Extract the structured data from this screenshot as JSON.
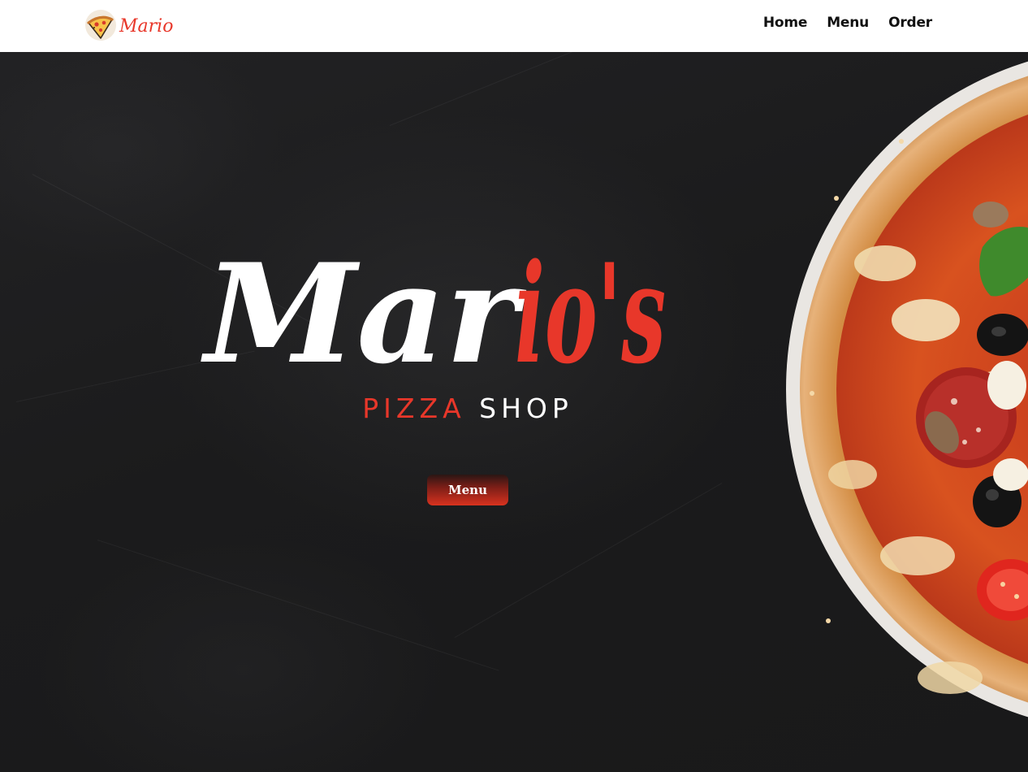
{
  "header": {
    "logo_text": "Mario",
    "logo_icon": "pizza-slice-icon",
    "nav": [
      {
        "label": "Home"
      },
      {
        "label": "Menu"
      },
      {
        "label": "Order"
      }
    ]
  },
  "hero": {
    "title_main": "Mar",
    "title_accent": "io's",
    "tagline_red": "PIZZA",
    "tagline_white": "SHOP",
    "button_label": "Menu",
    "decor_image": "pizza-photo"
  },
  "colors": {
    "accent": "#e8372a",
    "background": "#1c1c1d",
    "header_bg": "#ffffff",
    "text_light": "#ffffff",
    "nav_text": "#111111"
  }
}
